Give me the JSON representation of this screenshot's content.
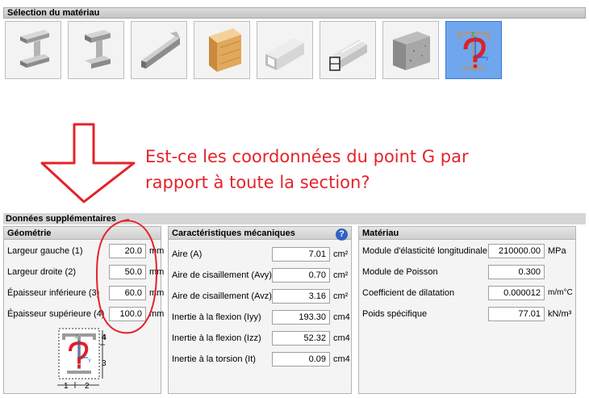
{
  "selection_panel": {
    "title": "Sélection du matériau"
  },
  "materials": [
    {
      "icon": "steel-i-beam-icon"
    },
    {
      "icon": "steel-h-beam-icon"
    },
    {
      "icon": "steel-angle-icon"
    },
    {
      "icon": "timber-beam-icon"
    },
    {
      "icon": "aluminium-tube-icon"
    },
    {
      "icon": "aluminium-profile-icon"
    },
    {
      "icon": "concrete-block-icon"
    },
    {
      "icon": "custom-section-icon",
      "selected": true
    }
  ],
  "annotation": {
    "line1": "Est-ce les coordonnées du point G par",
    "line2": "rapport à toute la section?",
    "color": "#e4232a"
  },
  "extra": {
    "title": "Données supplémentaires"
  },
  "geometry": {
    "title": "Géométrie",
    "fields": [
      {
        "label": "Largeur gauche (1)",
        "value": "20.0",
        "unit": "mm"
      },
      {
        "label": "Largeur droite (2)",
        "value": "50.0",
        "unit": "mm"
      },
      {
        "label": "Épaisseur inférieure (3)",
        "value": "60.0",
        "unit": "mm"
      },
      {
        "label": "Épaisseur supérieure (4)",
        "value": "100.0",
        "unit": "mm"
      }
    ],
    "diagram": {
      "label_1": "1",
      "label_2": "2",
      "label_3": "3",
      "label_4": "4",
      "axis_z": "Z",
      "axis_y": "Y"
    }
  },
  "mechanical": {
    "title": "Caractéristiques mécaniques",
    "help": "?",
    "fields": [
      {
        "label": "Aire (A)",
        "value": "7.01",
        "unit": "cm²"
      },
      {
        "label": "Aire de cisaillement (Avy)",
        "value": "0.70",
        "unit": "cm²"
      },
      {
        "label": "Aire de cisaillement (Avz)",
        "value": "3.16",
        "unit": "cm²"
      },
      {
        "label": "Inertie à la flexion (Iyy)",
        "value": "193.30",
        "unit": "cm4"
      },
      {
        "label": "Inertie à la flexion (Izz)",
        "value": "52.32",
        "unit": "cm4"
      },
      {
        "label": "Inertie à la torsion (It)",
        "value": "0.09",
        "unit": "cm4"
      }
    ]
  },
  "material": {
    "title": "Matériau",
    "fields": [
      {
        "label": "Module d'élasticité longitudinale",
        "value": "210000.00",
        "unit": "MPa"
      },
      {
        "label": "Module de Poisson",
        "value": "0.300",
        "unit": ""
      },
      {
        "label": "Coefficient de dilatation",
        "value": "0.000012",
        "unit": "m/m°C"
      },
      {
        "label": "Poids spécifique",
        "value": "77.01",
        "unit": "kN/m³"
      }
    ]
  }
}
